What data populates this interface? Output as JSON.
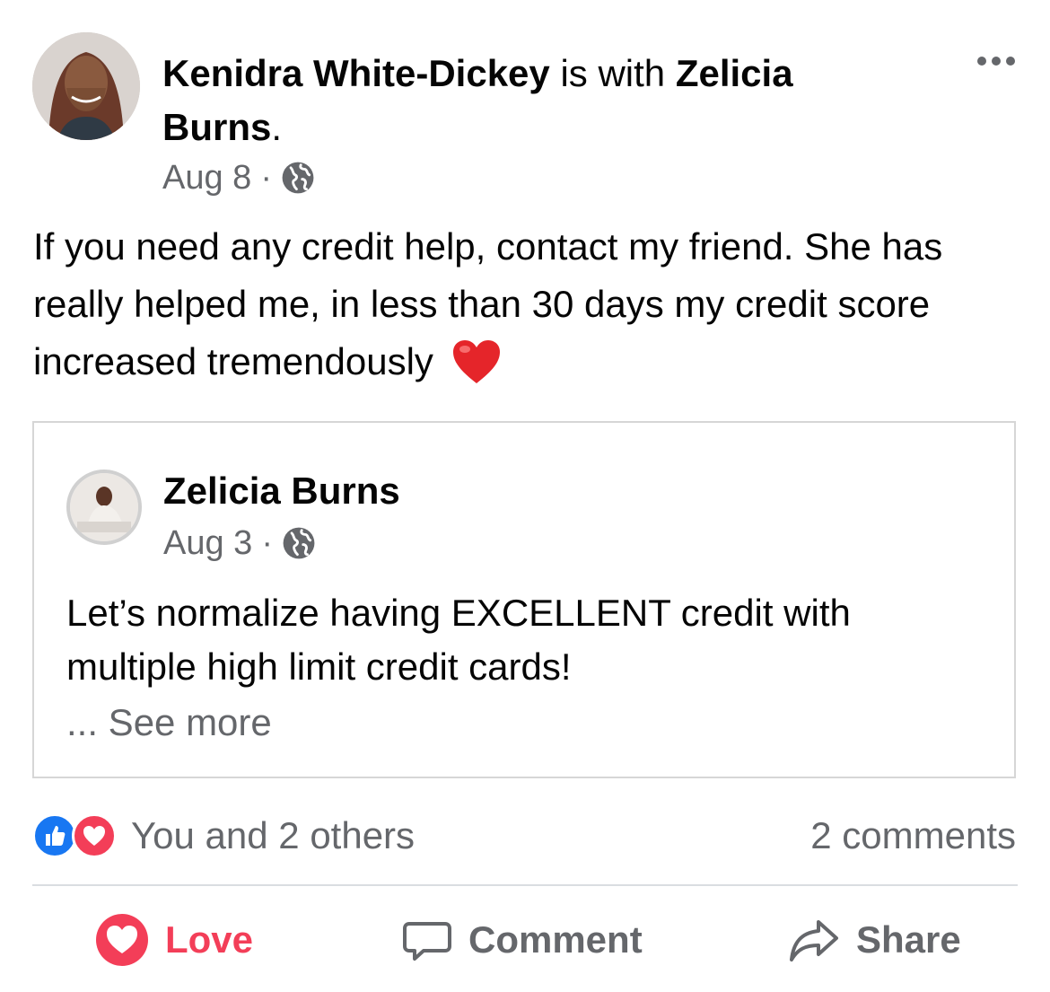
{
  "post": {
    "author": "Kenidra White-Dickey",
    "with_text": " is with ",
    "tagged": "Zelicia Burns",
    "tagged_suffix": ".",
    "date": "Aug 8",
    "separator": "·",
    "audience_icon": "globe-icon",
    "body_line1": "If you need any credit help, contact my friend. She has really helped me, in less than 30 days my credit score increased tremendously",
    "emoji": "red-heart-emoji",
    "more_icon": "more-options-icon"
  },
  "shared": {
    "author": "Zelicia Burns",
    "date": "Aug 3",
    "separator": "·",
    "audience_icon": "globe-icon",
    "text": "Let’s normalize having EXCELLENT credit with multiple high limit credit cards!",
    "see_more": "... See more"
  },
  "reactions": {
    "icons": [
      "like-icon",
      "love-icon"
    ],
    "summary": "You and 2 others",
    "comments": "2 comments"
  },
  "actions": {
    "love": "Love",
    "comment": "Comment",
    "share": "Share"
  },
  "colors": {
    "like_blue": "#1877f2",
    "love_red": "#f33e58",
    "secondary_text": "#65676b"
  }
}
